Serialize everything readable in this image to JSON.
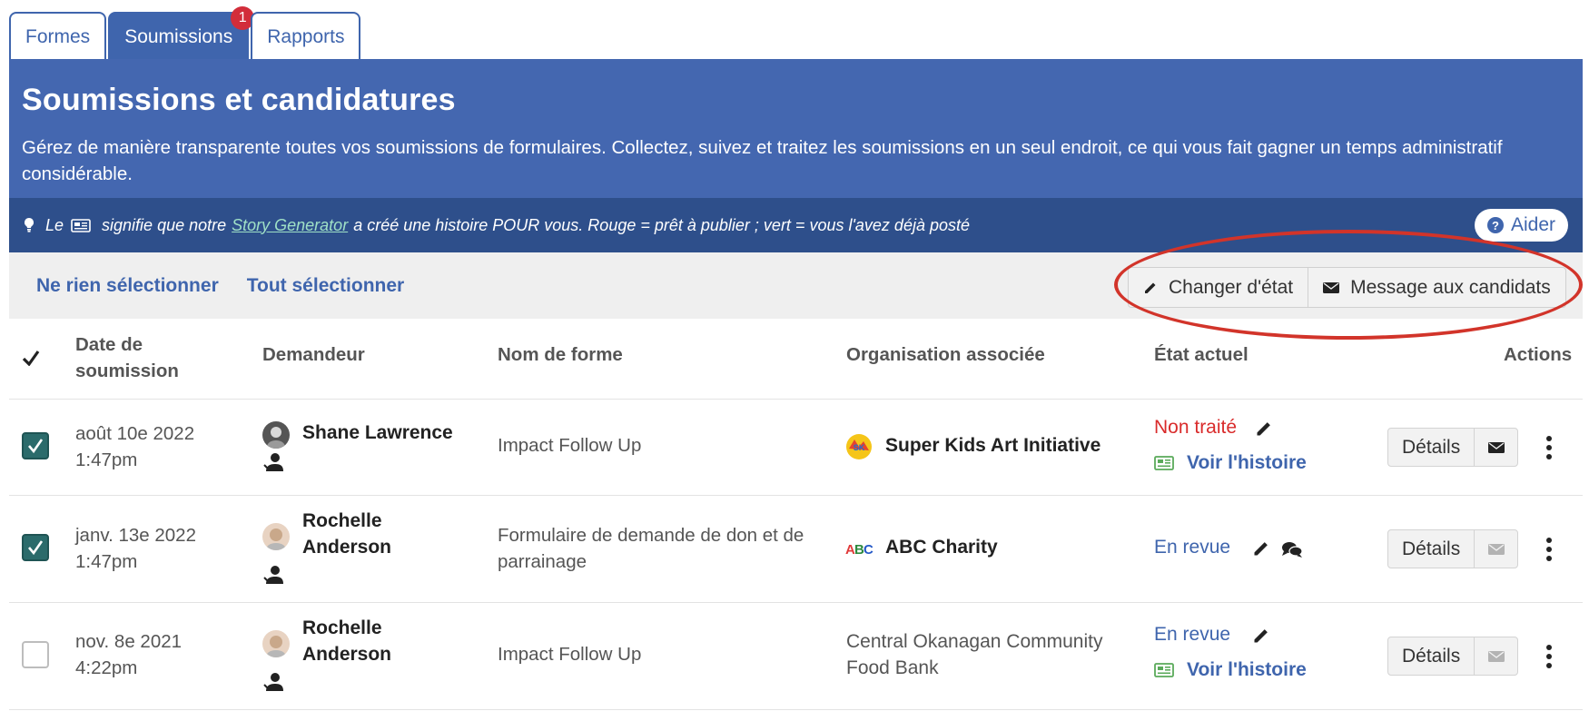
{
  "tabs": [
    {
      "label": "Formes"
    },
    {
      "label": "Soumissions",
      "badge": "1"
    },
    {
      "label": "Rapports"
    }
  ],
  "banner": {
    "title": "Soumissions et candidatures",
    "description": "Gérez de manière transparente toutes vos soumissions de formulaires. Collectez, suivez et traitez les soumissions en un seul endroit, ce qui vous fait gagner un temps administratif considérable."
  },
  "strip": {
    "prefix": "Le",
    "middle": "signifie que notre",
    "link": "Story Generator",
    "suffix": "a créé une histoire POUR vous. Rouge = prêt à publier ; vert = vous l'avez déjà posté",
    "help_label": "Aider"
  },
  "toolbar": {
    "select_none": "Ne rien sélectionner",
    "select_all": "Tout sélectionner",
    "change_state": "Changer d'état",
    "message_candidates": "Message aux candidats"
  },
  "table": {
    "headers": {
      "date": "Date de soumission",
      "applicant": "Demandeur",
      "form": "Nom de forme",
      "org": "Organisation associée",
      "state": "État actuel",
      "actions": "Actions"
    },
    "rows": [
      {
        "checked": true,
        "date": "août 10e 2022",
        "time": "1:47pm",
        "applicant": "Shane Lawrence",
        "form": "Impact Follow Up",
        "org": "Super Kids Art Initiative",
        "status": "Non traité",
        "story": "Voir l'histoire",
        "details": "Détails"
      },
      {
        "checked": true,
        "date": "janv. 13e 2022",
        "time": "1:47pm",
        "applicant": "Rochelle Anderson",
        "form": "Formulaire de demande de don et de parrainage",
        "org": "ABC Charity",
        "status": "En revue",
        "details": "Détails"
      },
      {
        "checked": false,
        "date": "nov. 8e 2021",
        "time": "4:22pm",
        "applicant": "Rochelle Anderson",
        "form": "Impact Follow Up",
        "org": "Central Okanagan Community Food Bank",
        "status": "En revue",
        "story": "Voir l'histoire",
        "details": "Détails"
      }
    ]
  },
  "colors": {
    "primary": "#3f65ad",
    "banner": "#4467b0",
    "strip": "#2e4f8b",
    "status_red": "#d92b2b",
    "story_green": "#5aaa5a",
    "annotation": "#d2342a"
  }
}
